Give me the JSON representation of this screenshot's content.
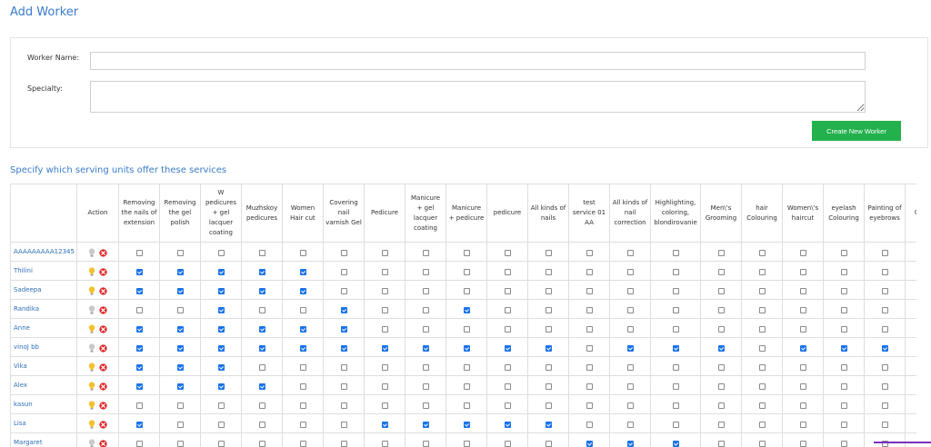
{
  "header": {
    "title": "Add Worker"
  },
  "form": {
    "worker_name_label": "Worker Name:",
    "specialty_label": "Specialty:",
    "worker_name_value": "",
    "specialty_value": "",
    "create_button_label": "Create New Worker"
  },
  "services_section": {
    "title": "Specify which serving units offer these services"
  },
  "table": {
    "action_header": "Action",
    "columns": [
      "Removing the nails of extension",
      "Removing the gel polish",
      "W pedicures + gel lacquer coating",
      "Muzhskoy pedicures",
      "Women Hair cut",
      "Covering nail varnish Gel",
      "Pedicure",
      "Manicure + gel lacquer coating",
      "Manicure + pedicure",
      "pedicure",
      "All kinds of nails",
      "test service 01 AA",
      "All kinds of nail correction",
      "Highlighting, coloring, blondirovanie",
      "Men\\'s Grooming",
      "hair Colouring",
      "Women\\'s haircut",
      "eyelash Colouring",
      "Painting of eyebrows",
      "Chil ha"
    ],
    "rows": [
      {
        "name": "AAAAAAAAA12345",
        "bulb": "off",
        "checks": [
          0,
          0,
          0,
          0,
          0,
          0,
          0,
          0,
          0,
          0,
          0,
          0,
          0,
          0,
          0,
          0,
          0,
          0,
          0,
          0
        ]
      },
      {
        "name": "Thilini",
        "bulb": "on",
        "checks": [
          1,
          1,
          1,
          1,
          1,
          0,
          0,
          0,
          0,
          0,
          0,
          0,
          0,
          0,
          0,
          0,
          0,
          0,
          0,
          0
        ]
      },
      {
        "name": "Sadeepa",
        "bulb": "on",
        "checks": [
          1,
          1,
          1,
          1,
          1,
          0,
          0,
          0,
          0,
          0,
          0,
          0,
          0,
          0,
          0,
          0,
          0,
          0,
          0,
          0
        ]
      },
      {
        "name": "Randika",
        "bulb": "off",
        "checks": [
          0,
          0,
          1,
          0,
          0,
          1,
          0,
          0,
          1,
          0,
          0,
          0,
          0,
          0,
          0,
          0,
          0,
          0,
          0,
          0
        ]
      },
      {
        "name": "Anne",
        "bulb": "on",
        "checks": [
          1,
          1,
          1,
          1,
          1,
          1,
          0,
          0,
          0,
          0,
          0,
          0,
          0,
          0,
          0,
          0,
          0,
          0,
          0,
          0
        ]
      },
      {
        "name": "vinoJ bb",
        "bulb": "off",
        "checks": [
          1,
          1,
          1,
          1,
          1,
          1,
          1,
          1,
          1,
          1,
          1,
          0,
          1,
          1,
          1,
          0,
          1,
          1,
          1,
          1
        ]
      },
      {
        "name": "Vika",
        "bulb": "on",
        "checks": [
          1,
          1,
          1,
          0,
          0,
          0,
          0,
          0,
          0,
          0,
          0,
          0,
          0,
          0,
          0,
          0,
          0,
          0,
          0,
          0
        ]
      },
      {
        "name": "Alex",
        "bulb": "on",
        "checks": [
          1,
          1,
          1,
          1,
          0,
          0,
          0,
          0,
          0,
          0,
          0,
          0,
          0,
          0,
          0,
          0,
          0,
          0,
          0,
          0
        ]
      },
      {
        "name": "kasun",
        "bulb": "on",
        "checks": [
          0,
          0,
          0,
          0,
          0,
          0,
          0,
          0,
          0,
          0,
          0,
          0,
          0,
          0,
          0,
          0,
          0,
          0,
          0,
          0
        ]
      },
      {
        "name": "Lisa",
        "bulb": "on",
        "checks": [
          1,
          0,
          0,
          0,
          0,
          0,
          1,
          1,
          1,
          1,
          1,
          0,
          0,
          0,
          0,
          0,
          0,
          0,
          0,
          0
        ]
      },
      {
        "name": "Margaret",
        "bulb": "off",
        "checks": [
          0,
          0,
          0,
          0,
          0,
          0,
          0,
          0,
          0,
          0,
          0,
          1,
          1,
          1,
          0,
          0,
          0,
          0,
          0,
          1
        ]
      }
    ]
  },
  "icons": {
    "bulb": "lightbulb-icon",
    "delete": "delete-icon"
  },
  "colors": {
    "accent_blue": "#3a7bc8",
    "button_green": "#22b14c",
    "checkbox_blue": "#1a73e8",
    "delete_red": "#e02424",
    "bulb_on": "#f2c12e",
    "bulb_off": "#c9c9c9"
  }
}
